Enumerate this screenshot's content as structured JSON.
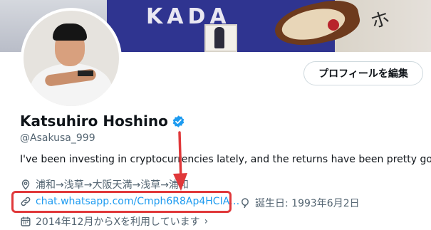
{
  "profile": {
    "name": "Katsuhiro Hoshino",
    "handle": "@Asakusa_999",
    "bio": "I've been investing in cryptocurrencies lately, and the returns have been pretty good.",
    "location": "浦和→浅草→大阪天満→浅草→浦和",
    "link": "chat.whatsapp.com/Cmph6R8Ap4HCIA…",
    "birthday": "誕生日: 1993年6月2日",
    "joined": "2014年12月からXを利用しています"
  },
  "actions": {
    "edit_profile_label": "プロフィールを編集"
  },
  "banner": {
    "jersey_text": "KADA",
    "sign_text": "ホ"
  },
  "colors": {
    "link": "#1d9bf0",
    "verified": "#1d9bf0",
    "annotation": "#e0383a",
    "muted_text": "#536471"
  },
  "icons": [
    "verified-badge-icon",
    "location-pin-icon",
    "link-icon",
    "balloon-icon",
    "calendar-icon",
    "chevron-right-icon"
  ]
}
